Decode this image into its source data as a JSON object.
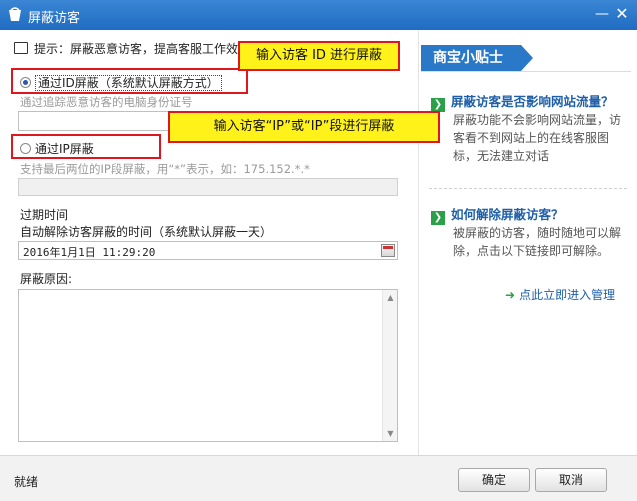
{
  "window": {
    "title": "屏蔽访客",
    "min_glyph": "—",
    "close_glyph": "✕"
  },
  "hint": {
    "text": "提示：屏蔽恶意访客，提高客服工作效"
  },
  "options": {
    "by_id": {
      "label": "通过ID屏蔽（系统默认屏蔽方式）",
      "checked": true,
      "description": "通过追踪恶意访客的电脑身份证号",
      "input_value": ""
    },
    "by_ip": {
      "label": "通过IP屏蔽",
      "checked": false,
      "description": "支持最后两位的IP段屏蔽，用“*”表示，如：175.152.*.*",
      "input_value": ""
    }
  },
  "expire": {
    "title": "过期时间",
    "description": "自动解除访客屏蔽的时间（系统默认屏蔽一天）",
    "value": "2016年1月1日  11:29:20"
  },
  "reason": {
    "label": "屏蔽原因:",
    "value": ""
  },
  "callouts": {
    "id": "输入访客 ID 进行屏蔽",
    "ip": "输入访客“IP”或“IP”段进行屏蔽"
  },
  "tips": {
    "header": "商宝小贴士",
    "q1": {
      "title": "屏蔽访客是否影响网站流量？",
      "body": "屏蔽功能不会影响网站流量，访客看不到网站上的在线客服图标，无法建立对话"
    },
    "q2": {
      "title": "如何解除屏蔽访客？",
      "body": "被屏蔽的访客，随时随地可以解除，点击以下链接即可解除。"
    },
    "link": "点此立即进入管理"
  },
  "footer": {
    "status": "就绪",
    "ok": "确定",
    "cancel": "取消"
  },
  "colors": {
    "title_bar": "#2a79c8",
    "highlight": "#e0161e",
    "callout_bg": "#fff21a",
    "link": "#1f5fa8",
    "arrow_green": "#2aa048"
  }
}
